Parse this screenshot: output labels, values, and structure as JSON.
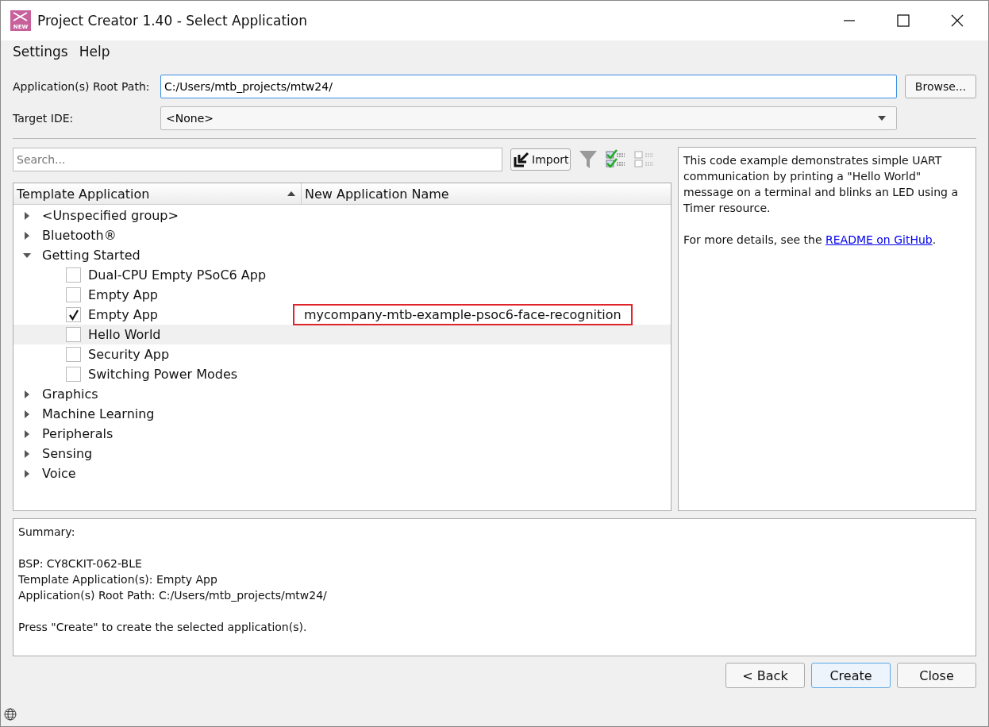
{
  "window": {
    "title": "Project Creator 1.40 - Select Application",
    "icon_label": "NEW"
  },
  "menu": [
    "Settings",
    "Help"
  ],
  "root_path": {
    "label": "Application(s) Root Path:",
    "value": "C:/Users/mtb_projects/mtw24/",
    "button": "Browse..."
  },
  "target_ide": {
    "label": "Target IDE:",
    "value": "<None>"
  },
  "search": {
    "placeholder": "Search..."
  },
  "import_button": "Import",
  "table": {
    "columns": [
      "Template Application",
      "New Application Name"
    ],
    "groups": [
      {
        "label": "<Unspecified group>",
        "expanded": false
      },
      {
        "label": "Bluetooth®",
        "expanded": false
      },
      {
        "label": "Getting Started",
        "expanded": true,
        "children": [
          {
            "label": "Dual-CPU Empty PSoC6 App",
            "checked": false,
            "selected": false
          },
          {
            "label": "Empty App",
            "checked": false,
            "selected": false
          },
          {
            "label": "Empty App",
            "checked": true,
            "selected": false,
            "new_name": "mycompany-mtb-example-psoc6-face-recognition"
          },
          {
            "label": "Hello World",
            "checked": false,
            "selected": true
          },
          {
            "label": "Security App",
            "checked": false,
            "selected": false
          },
          {
            "label": "Switching Power Modes",
            "checked": false,
            "selected": false
          }
        ]
      },
      {
        "label": "Graphics",
        "expanded": false
      },
      {
        "label": "Machine Learning",
        "expanded": false
      },
      {
        "label": "Peripherals",
        "expanded": false
      },
      {
        "label": "Sensing",
        "expanded": false
      },
      {
        "label": "Voice",
        "expanded": false
      }
    ]
  },
  "description": {
    "text": "This code example demonstrates simple UART communication by printing a \"Hello World\" message on a terminal and blinks an LED using a Timer resource.",
    "more_before": "For more details, see the ",
    "link": "README on GitHub",
    "more_after": "."
  },
  "summary": [
    [
      "Summary:"
    ],
    [
      "BSP: CY8CKIT-062-BLE",
      "Template Application(s): Empty App",
      "Application(s) Root Path: C:/Users/mtb_projects/mtw24/"
    ],
    [
      "Press \"Create\" to create the selected application(s)."
    ]
  ],
  "buttons": [
    {
      "label": "< Back",
      "default": false
    },
    {
      "label": "Create",
      "default": true
    },
    {
      "label": "Close",
      "default": false
    }
  ]
}
